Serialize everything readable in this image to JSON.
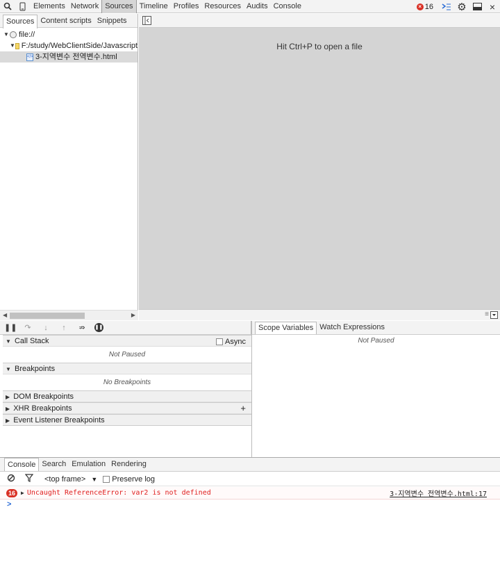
{
  "toolbar": {
    "tabs": [
      "Elements",
      "Network",
      "Sources",
      "Timeline",
      "Profiles",
      "Resources",
      "Audits",
      "Console"
    ],
    "error_count": "16"
  },
  "navigator": {
    "tabs": [
      "Sources",
      "Content scripts",
      "Snippets"
    ],
    "tree": [
      "file://",
      "F:/study/WebClientSide/Javascript",
      "3-지역변수 전역변수.html"
    ]
  },
  "editor": {
    "hint": "Hit Ctrl+P to open a file"
  },
  "debugger": {
    "call_stack": "Call Stack",
    "async_label": "Async",
    "not_paused": "Not Paused",
    "breakpoints": "Breakpoints",
    "no_breakpoints": "No Breakpoints",
    "dom_breakpoints": "DOM Breakpoints",
    "xhr_breakpoints": "XHR Breakpoints",
    "event_listener_breakpoints": "Event Listener Breakpoints",
    "add_symbol": "+"
  },
  "scope": {
    "tabs": [
      "Scope Variables",
      "Watch Expressions"
    ],
    "status": "Not Paused"
  },
  "drawer": {
    "tabs": [
      "Console",
      "Search",
      "Emulation",
      "Rendering"
    ],
    "frame": "<top frame>",
    "preserve_log": "Preserve log"
  },
  "console": {
    "error_count": "16",
    "error_message": "Uncaught ReferenceError: var2 is not defined",
    "error_source": "3-지역변수 전역변수.html:17",
    "prompt": ">"
  },
  "colors": {
    "error": "#d93025",
    "editor_bg": "#d4d4d4",
    "prompt": "#2a6cd6"
  }
}
